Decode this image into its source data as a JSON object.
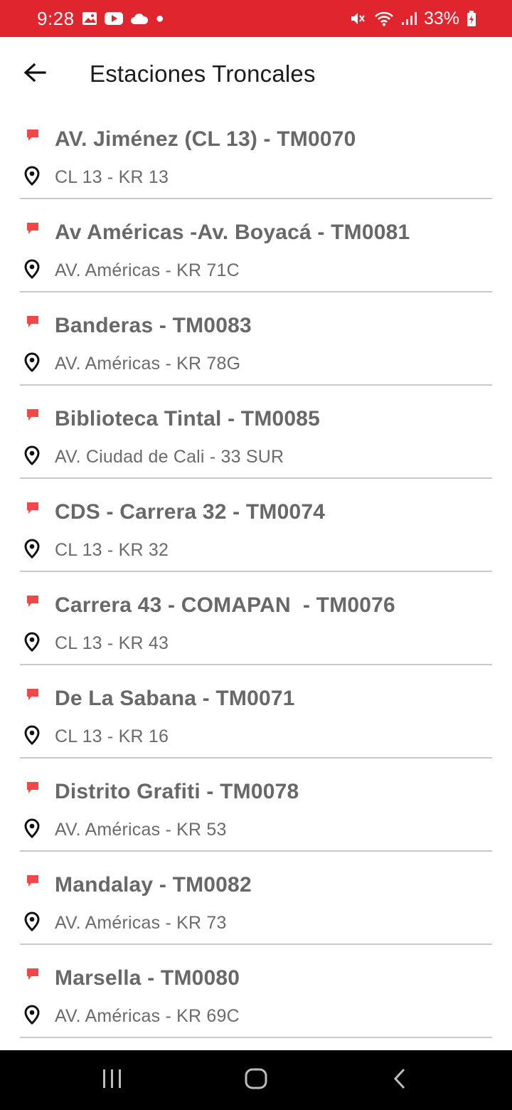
{
  "status_bar": {
    "time": "9:28",
    "battery": "33%",
    "background": "#e0252e",
    "left_icons": [
      "gallery-icon",
      "youtube-icon",
      "cloud-icon",
      "notification-dot"
    ],
    "right_icons": [
      "mute-icon",
      "wifi-icon",
      "signal-icon",
      "battery-charging-icon"
    ]
  },
  "header": {
    "title": "Estaciones Troncales",
    "back_icon": "arrow-left-icon"
  },
  "stations": [
    {
      "name": "AV. Jiménez (CL 13) - TM0070",
      "address": "CL 13 - KR 13"
    },
    {
      "name": "Av Américas -Av. Boyacá - TM0081",
      "address": "AV. Américas - KR 71C"
    },
    {
      "name": "Banderas - TM0083",
      "address": "AV. Américas - KR 78G"
    },
    {
      "name": "Biblioteca Tintal - TM0085",
      "address": "AV. Ciudad de Cali - 33 SUR"
    },
    {
      "name": "CDS - Carrera 32 - TM0074",
      "address": "CL 13 - KR 32"
    },
    {
      "name": "Carrera 43 - COMAPAN  - TM0076",
      "address": "CL 13 - KR 43"
    },
    {
      "name": "De La Sabana - TM0071",
      "address": "CL 13 - KR 16"
    },
    {
      "name": "Distrito Grafiti - TM0078",
      "address": "AV. Américas - KR 53"
    },
    {
      "name": "Mandalay - TM0082",
      "address": "AV. Américas - KR 73"
    },
    {
      "name": "Marsella - TM0080",
      "address": "AV. Américas - KR 69C"
    }
  ],
  "colors": {
    "accent": "#e0252e",
    "flag": "#f04848",
    "text_primary": "#686868",
    "divider": "#c9c9c9"
  },
  "nav_bar": {
    "buttons": [
      "recent-apps-icon",
      "home-icon",
      "back-icon"
    ]
  }
}
